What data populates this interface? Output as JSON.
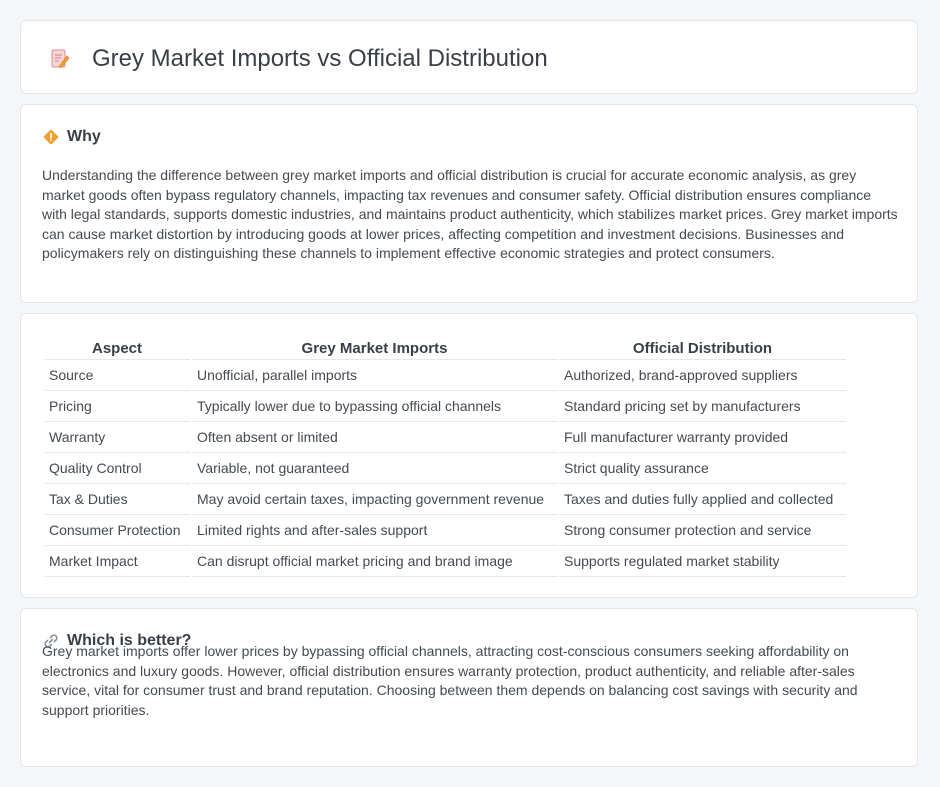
{
  "header": {
    "title": "Grey Market Imports vs Official Distribution",
    "icon": "document-pencil-icon"
  },
  "why": {
    "heading": "Why",
    "icon": "diamond-warning-icon",
    "text": "Understanding the difference between grey market imports and official distribution is crucial for accurate economic analysis, as grey market goods often bypass regulatory channels, impacting tax revenues and consumer safety. Official distribution ensures compliance with legal standards, supports domestic industries, and maintains product authenticity, which stabilizes market prices. Grey market imports can cause market distortion by introducing goods at lower prices, affecting competition and investment decisions. Businesses and policymakers rely on distinguishing these channels to implement effective economic strategies and protect consumers."
  },
  "table": {
    "headers": [
      "Aspect",
      "Grey Market Imports",
      "Official Distribution"
    ],
    "rows": [
      [
        "Source",
        "Unofficial, parallel imports",
        "Authorized, brand-approved suppliers"
      ],
      [
        "Pricing",
        "Typically lower due to bypassing official channels",
        "Standard pricing set by manufacturers"
      ],
      [
        "Warranty",
        "Often absent or limited",
        "Full manufacturer warranty provided"
      ],
      [
        "Quality Control",
        "Variable, not guaranteed",
        "Strict quality assurance"
      ],
      [
        "Tax & Duties",
        "May avoid certain taxes, impacting government revenue",
        "Taxes and duties fully applied and collected"
      ],
      [
        "Consumer Protection",
        "Limited rights and after-sales support",
        "Strong consumer protection and service"
      ],
      [
        "Market Impact",
        "Can disrupt official market pricing and brand image",
        "Supports regulated market stability"
      ]
    ]
  },
  "better": {
    "heading": "Which is better?",
    "icon": "link-icon",
    "text": "Grey market imports offer lower prices by bypassing official channels, attracting cost-conscious consumers seeking affordability on electronics and luxury goods. However, official distribution ensures warranty protection, product authenticity, and reliable after-sales service, vital for consumer trust and brand reputation. Choosing between them depends on balancing cost savings with security and support priorities."
  },
  "colors": {
    "accent_orange": "#f0a030",
    "icon_pink": "#e58a8a",
    "border": "#e2e5ea",
    "background": "#f5f6f8"
  }
}
